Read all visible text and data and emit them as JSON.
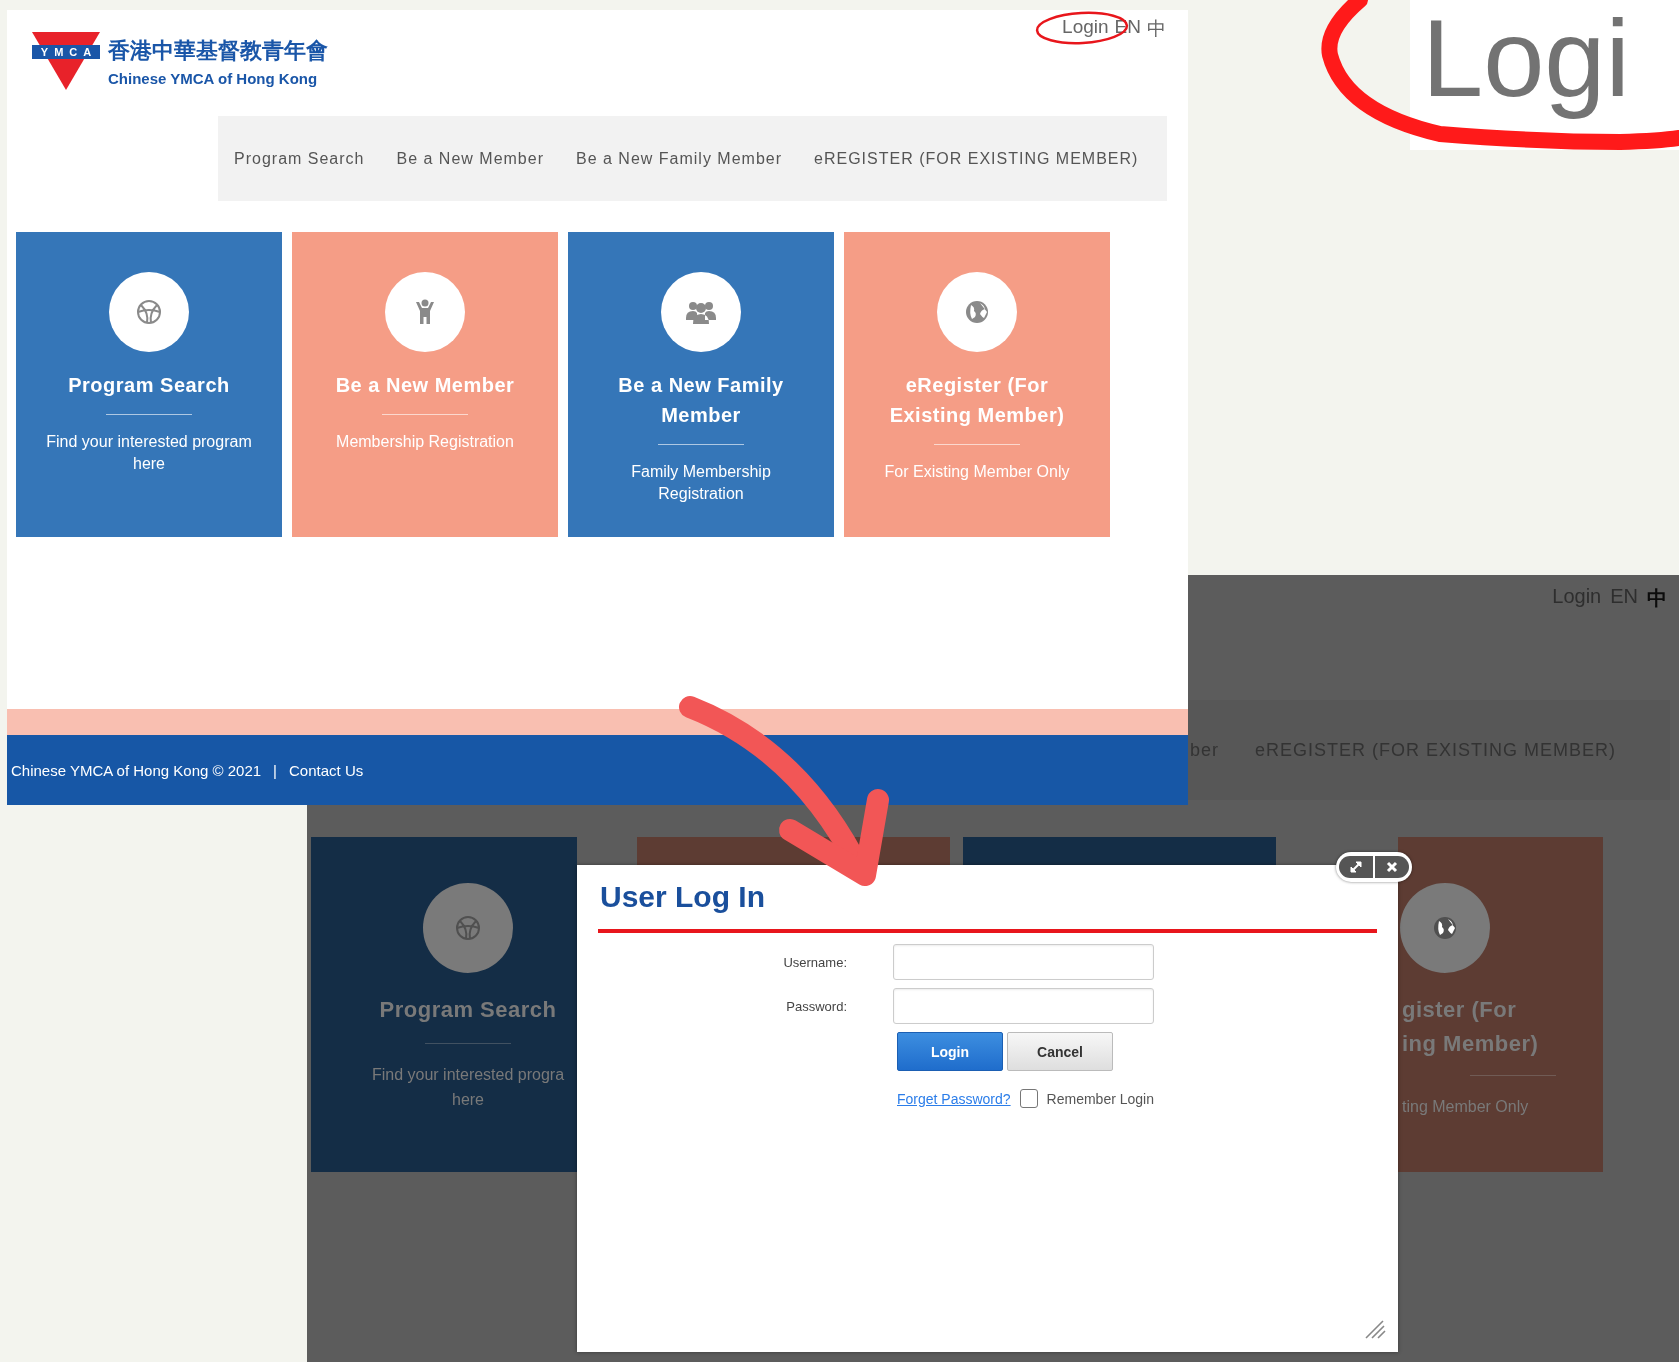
{
  "zoom_callout": {
    "text": "Logi"
  },
  "site": {
    "logo": {
      "mark": "YMCA",
      "chinese_name": "香港中華基督教青年會",
      "english_name": "Chinese YMCA of Hong Kong"
    },
    "top_links": [
      "Login",
      "EN",
      "中"
    ],
    "nav": [
      "Program Search",
      "Be a New Member",
      "Be a New Family Member",
      "eREGISTER (FOR EXISTING MEMBER)"
    ],
    "cards": [
      {
        "kind": "ball",
        "color": "#3576b8",
        "title": "Program Search",
        "subtitle": "Find your interested program here"
      },
      {
        "kind": "person",
        "color": "#f59d86",
        "title": "Be a New Member",
        "subtitle": "Membership Registration"
      },
      {
        "kind": "group",
        "color": "#3576b8",
        "title": "Be a New Family Member",
        "subtitle": "Family Membership Registration"
      },
      {
        "kind": "globe",
        "color": "#f59d86",
        "title": "eRegister (For Existing Member)",
        "subtitle": "For Existing Member Only"
      }
    ],
    "footer": {
      "copyright": "Chinese YMCA of Hong Kong © 2021",
      "separator": "|",
      "contact": "Contact Us"
    }
  },
  "dimmed_page": {
    "top_links": [
      "Login",
      "EN",
      "中"
    ],
    "nav": [
      "ber",
      "eREGISTER (FOR EXISTING MEMBER)"
    ],
    "cards": [
      {
        "kind": "ball",
        "color": "#142d46",
        "title_lines": [
          "Program Search"
        ],
        "subtitle_lines": [
          "Find your interested progra",
          "here"
        ]
      },
      {
        "kind": "plain",
        "color": "#5d3c33"
      },
      {
        "kind": "plain",
        "color": "#142d46"
      },
      {
        "kind": "globe",
        "color": "#5d3c33",
        "title_lines": [
          "gister (For",
          "ing Member)"
        ],
        "subtitle_lines": [
          "ting Member Only"
        ]
      }
    ]
  },
  "login_dialog": {
    "title": "User Log In",
    "fields": [
      {
        "label": "Username:"
      },
      {
        "label": "Password:"
      }
    ],
    "buttons": [
      {
        "label": "Login",
        "kind": "primary"
      },
      {
        "label": "Cancel",
        "kind": "secondary"
      }
    ],
    "forgot_link": "Forget Password?",
    "remember": {
      "label": "Remember Login",
      "checked": false
    }
  }
}
